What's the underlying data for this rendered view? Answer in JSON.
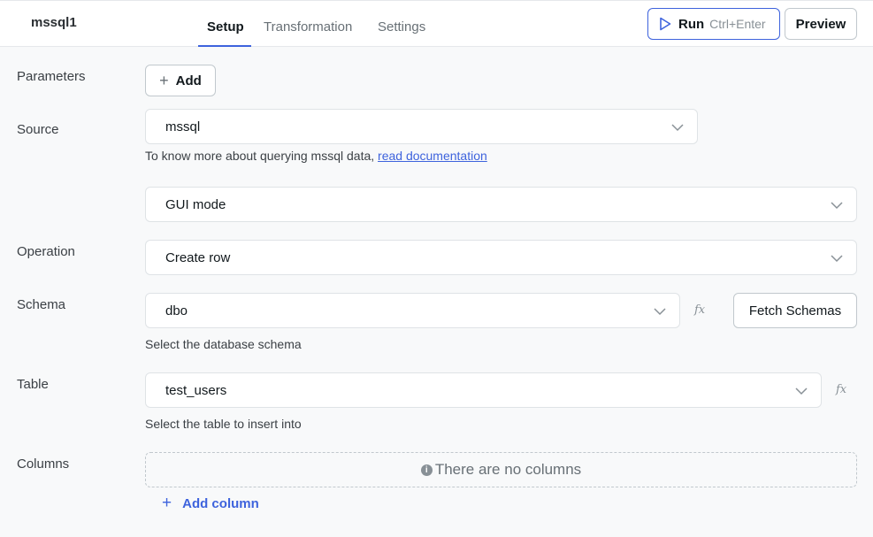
{
  "header": {
    "query_name": "mssql1",
    "tabs": [
      {
        "label": "Setup",
        "active": true
      },
      {
        "label": "Transformation",
        "active": false
      },
      {
        "label": "Settings",
        "active": false
      }
    ],
    "run_label": "Run",
    "run_shortcut": "Ctrl+Enter",
    "preview_label": "Preview"
  },
  "form": {
    "parameters": {
      "label": "Parameters",
      "add_label": "Add"
    },
    "source": {
      "label": "Source",
      "value": "mssql",
      "help_prefix": "To know more about querying mssql data,",
      "help_link": "read documentation"
    },
    "mode": {
      "value": "GUI mode"
    },
    "operation": {
      "label": "Operation",
      "value": "Create row"
    },
    "schema": {
      "label": "Schema",
      "value": "dbo",
      "fx": "fx",
      "fetch_label": "Fetch Schemas",
      "help": "Select the database schema"
    },
    "table": {
      "label": "Table",
      "value": "test_users",
      "fx": "fx",
      "help": "Select the table to insert into"
    },
    "columns": {
      "label": "Columns",
      "empty_text": "There are no columns",
      "info_icon_glyph": "i",
      "add_label": "Add column"
    }
  },
  "colors": {
    "accent": "#3e63dd",
    "background": "#f8f9fa",
    "border": "#dfe3e6"
  },
  "icons": {
    "run": "play-icon",
    "dropdown": "chevron-down-icon",
    "info": "info-icon",
    "plus": "plus-icon"
  }
}
